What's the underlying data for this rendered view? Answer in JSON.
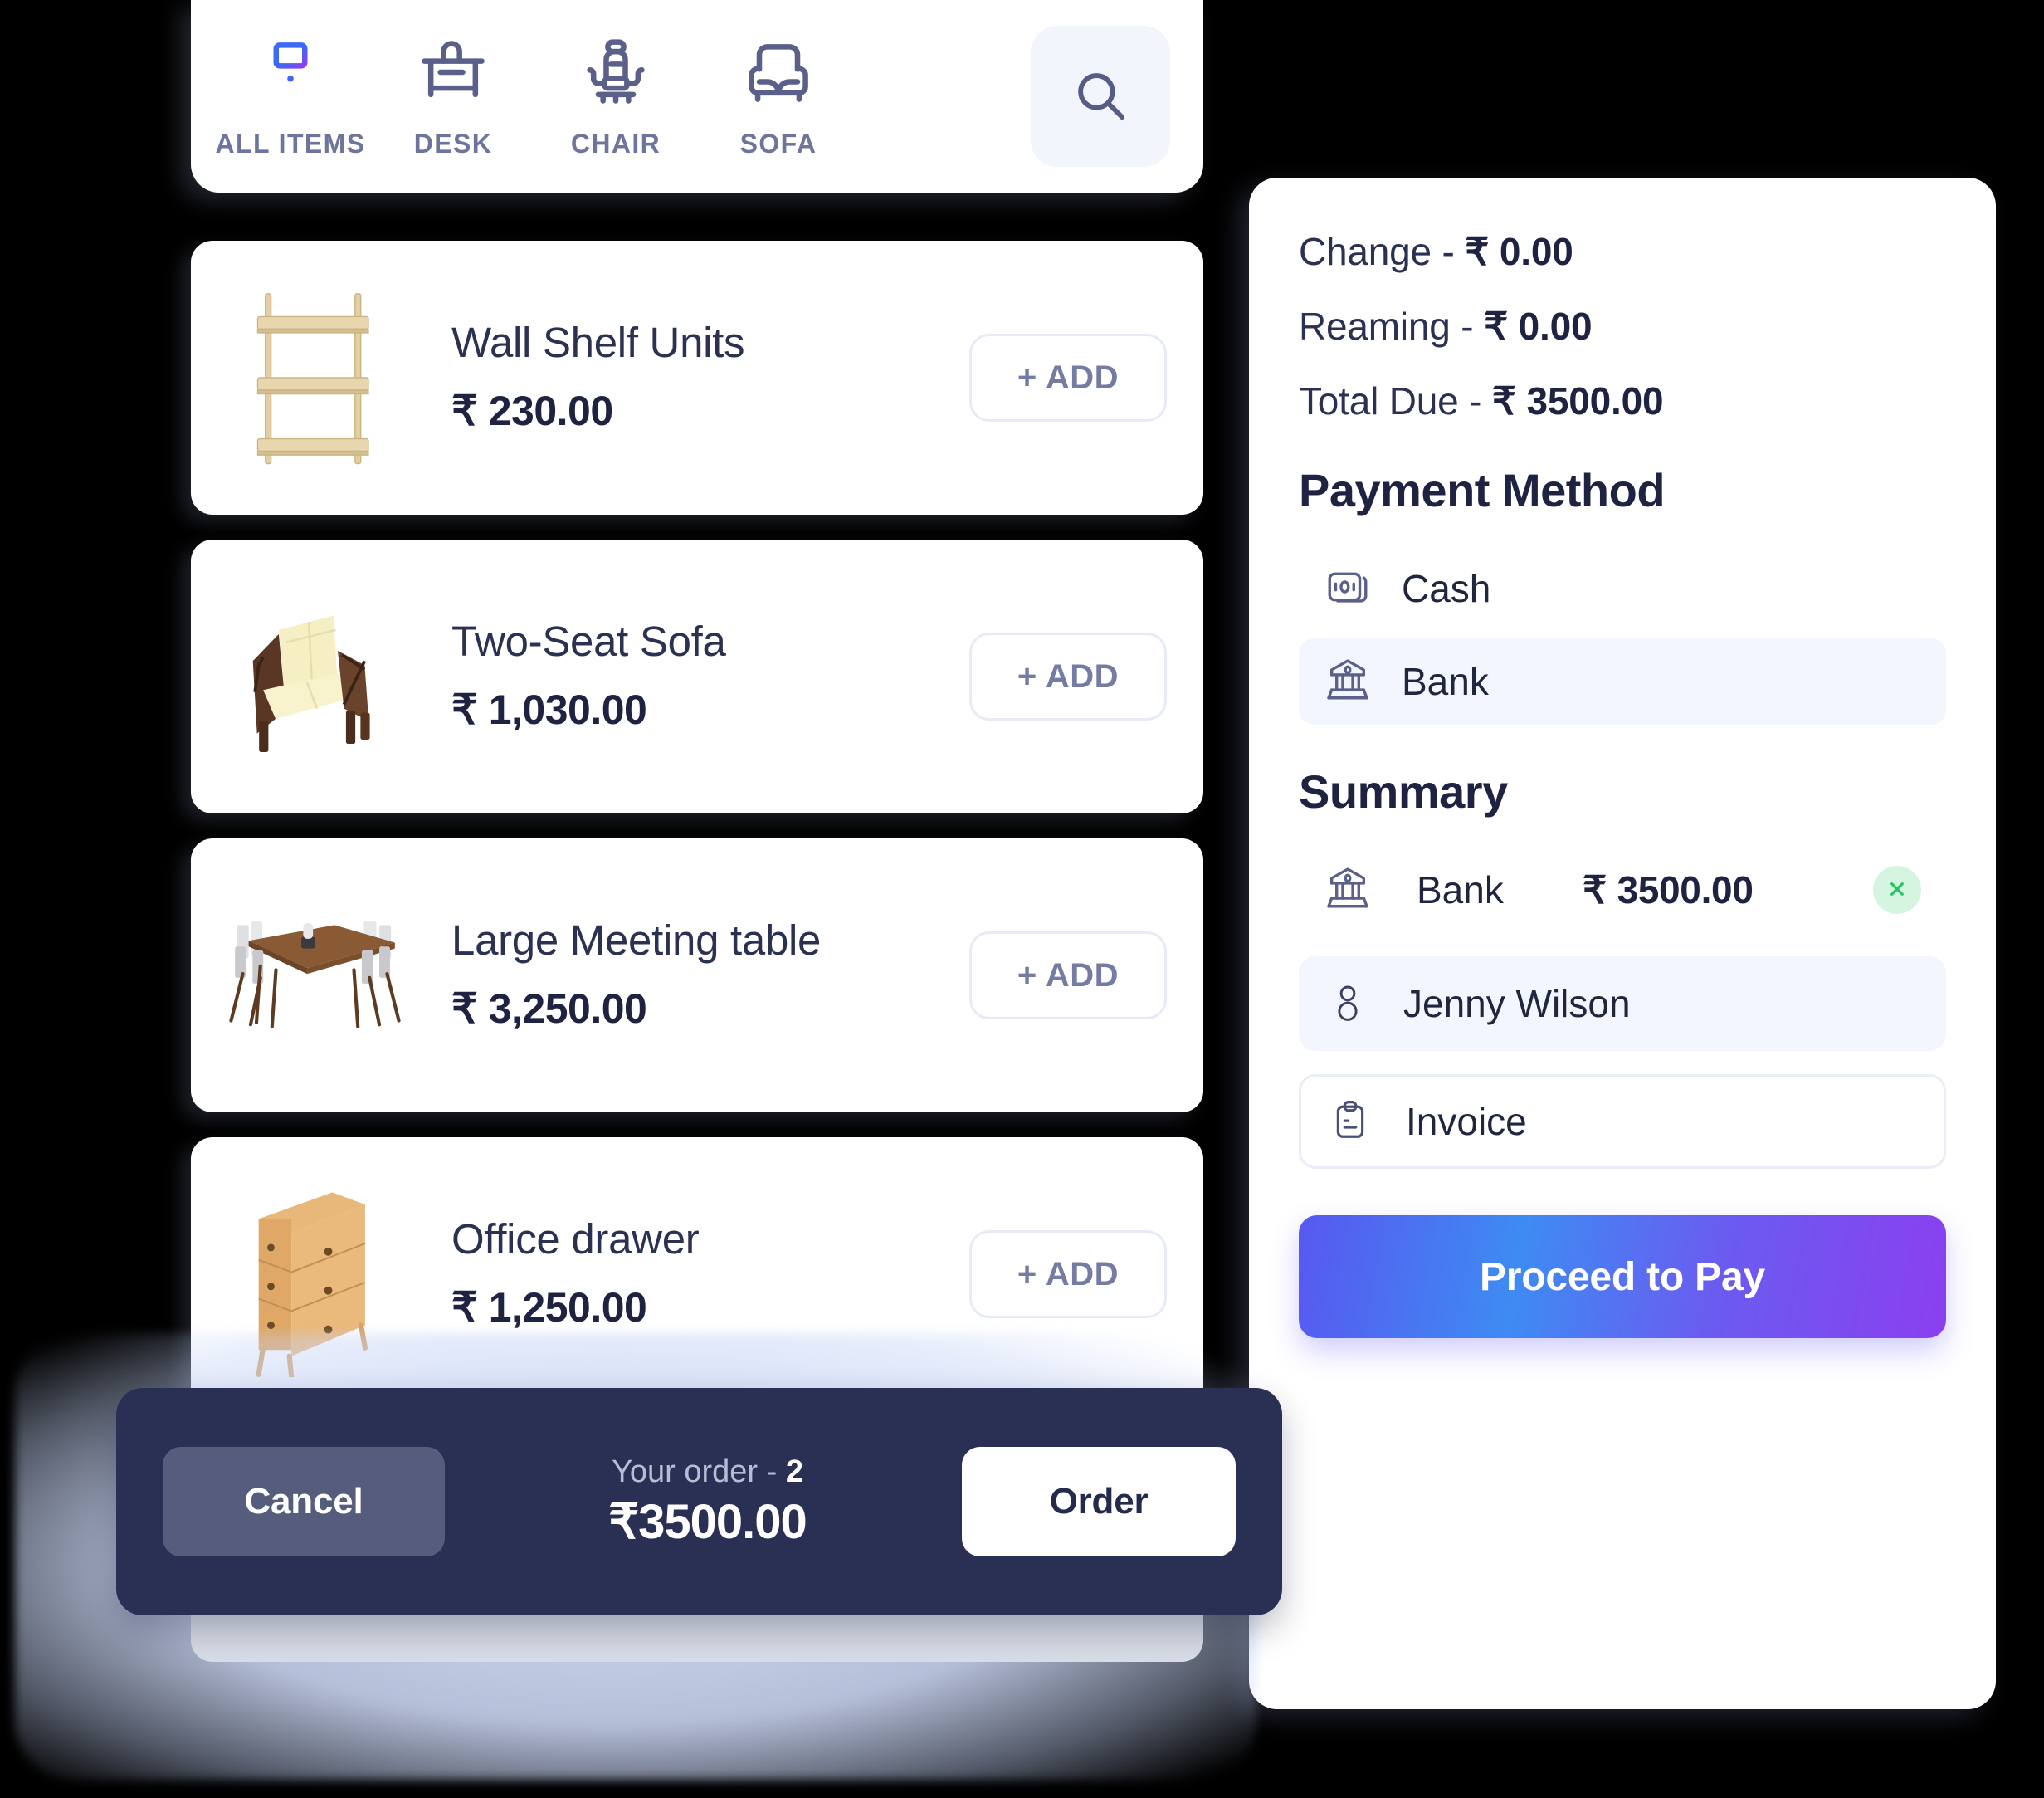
{
  "tabs": [
    {
      "label": "ALL ITEMS",
      "icon": "dresser-icon",
      "active": true
    },
    {
      "label": "DESK",
      "icon": "desk-icon",
      "active": false
    },
    {
      "label": "CHAIR",
      "icon": "office-chair-icon",
      "active": false
    },
    {
      "label": "SOFA",
      "icon": "sofa-icon",
      "active": false
    }
  ],
  "search": {
    "icon": "search-icon"
  },
  "products": [
    {
      "name": "Wall Shelf Units",
      "price": "₹ 230.00",
      "add_label": "+ ADD",
      "thumb": "wall-shelf-thumb"
    },
    {
      "name": "Two-Seat Sofa",
      "price": "₹ 1,030.00",
      "add_label": "+ ADD",
      "thumb": "two-seat-sofa-thumb"
    },
    {
      "name": "Large Meeting table",
      "price": "₹ 3,250.00",
      "add_label": "+ ADD",
      "thumb": "meeting-table-thumb"
    },
    {
      "name": "Office drawer",
      "price": "₹ 1,250.00",
      "add_label": "+ ADD",
      "thumb": "office-drawer-thumb"
    }
  ],
  "checkout": {
    "totals": [
      {
        "label": "Change - ",
        "value": "₹ 0.00"
      },
      {
        "label": "Reaming - ",
        "value": "₹ 0.00"
      },
      {
        "label": "Total Due - ",
        "value": "₹ 3500.00"
      }
    ],
    "payment_method_title": "Payment Method",
    "payment_methods": [
      {
        "label": "Cash",
        "icon": "banknote-icon",
        "selected": false
      },
      {
        "label": "Bank",
        "icon": "bank-icon",
        "selected": true
      }
    ],
    "summary_title": "Summary",
    "summary_rows": [
      {
        "method": "Bank",
        "icon": "bank-icon",
        "amount": "₹ 3500.00",
        "remove_icon": "close-icon"
      }
    ],
    "customer": {
      "label": "Jenny Wilson",
      "icon": "user-icon"
    },
    "invoice": {
      "label": "Invoice",
      "icon": "clipboard-icon"
    },
    "pay_button": "Proceed to Pay"
  },
  "order_bar": {
    "cancel_label": "Cancel",
    "order_prefix": "Your order - ",
    "order_count": "2",
    "order_total": "₹3500.00",
    "order_label": "Order"
  },
  "colors": {
    "accent_start": "#5858ef",
    "accent_mid": "#3e8bf3",
    "accent_end": "#8b3ff0",
    "navy": "#2a3054",
    "slate": "#6d759c",
    "selected_bg": "#f3f6fe",
    "remove_green": "#22c55e"
  }
}
